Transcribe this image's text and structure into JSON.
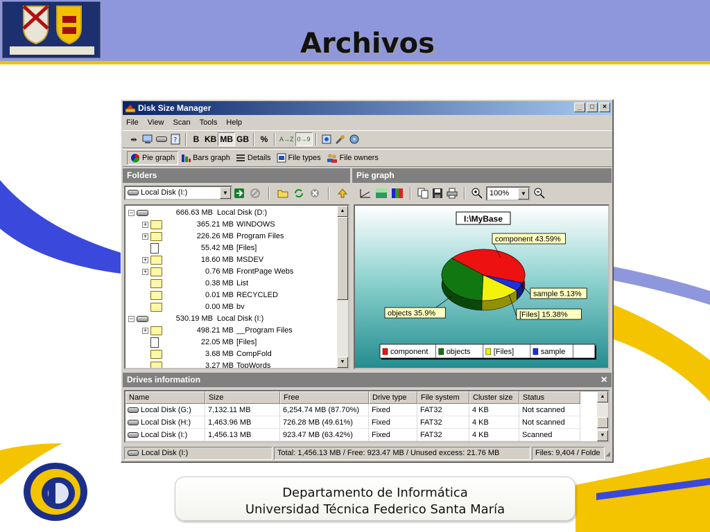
{
  "slide": {
    "title": "Archivos",
    "footer_line1": "Departamento de  Informática",
    "footer_line2": "Universidad Técnica Federico Santa María",
    "colors": {
      "header": "#8f97dc",
      "accent_gold": "#f2c200",
      "swoosh_blue": "#3344d8"
    }
  },
  "app": {
    "title": "Disk Size Manager",
    "menu": [
      "File",
      "View",
      "Scan",
      "Tools",
      "Help"
    ],
    "caption_buttons": {
      "minimize": "_",
      "maximize": "□",
      "close": "×"
    },
    "units": {
      "b": "B",
      "kb": "KB",
      "mb": "MB",
      "gb": "GB",
      "percent": "%",
      "sort_az": "A→Z",
      "sort_09": "0→9",
      "selected": "MB"
    },
    "views": {
      "pie": "Pie graph",
      "bars": "Bars graph",
      "details": "Details",
      "file_types": "File types",
      "file_owners": "File owners",
      "selected": "Pie graph"
    },
    "folders_pane": {
      "header": "Folders",
      "drive_select": "Local Disk (I:)",
      "tree": [
        {
          "level": 0,
          "expander": "−",
          "icon": "drive",
          "size": "666.63 MB",
          "name": "Local Disk (D:)"
        },
        {
          "level": 1,
          "expander": "+",
          "icon": "folder",
          "size": "365.21 MB",
          "name": "WINDOWS"
        },
        {
          "level": 1,
          "expander": "+",
          "icon": "folder",
          "size": "226.26 MB",
          "name": "Program Files"
        },
        {
          "level": 1,
          "expander": "",
          "icon": "file",
          "size": "55.42 MB",
          "name": "[Files]"
        },
        {
          "level": 1,
          "expander": "+",
          "icon": "folder",
          "size": "18.60 MB",
          "name": "MSDEV"
        },
        {
          "level": 1,
          "expander": "+",
          "icon": "folder",
          "size": "0.76 MB",
          "name": "FrontPage Webs"
        },
        {
          "level": 1,
          "expander": "",
          "icon": "folder",
          "size": "0.38 MB",
          "name": "List"
        },
        {
          "level": 1,
          "expander": "",
          "icon": "folder",
          "size": "0.01 MB",
          "name": "RECYCLED"
        },
        {
          "level": 1,
          "expander": "",
          "icon": "folder",
          "size": "0.00 MB",
          "name": "bv"
        },
        {
          "level": 0,
          "expander": "−",
          "icon": "drive",
          "size": "530.19 MB",
          "name": "Local Disk (I:)"
        },
        {
          "level": 1,
          "expander": "+",
          "icon": "folder",
          "size": "498.21 MB",
          "name": "__Program Files"
        },
        {
          "level": 1,
          "expander": "",
          "icon": "file",
          "size": "22.05 MB",
          "name": "[Files]"
        },
        {
          "level": 1,
          "expander": "",
          "icon": "folder",
          "size": "3.68 MB",
          "name": "CompFold"
        },
        {
          "level": 1,
          "expander": "",
          "icon": "folder",
          "size": "3.27 MB",
          "name": "TopWords"
        }
      ]
    },
    "graph_pane": {
      "header": "Pie graph",
      "zoom": "100%",
      "chart_title": "I:\\MyBase",
      "slices": [
        {
          "name": "component",
          "percent": 43.59,
          "label": "component 43.59%",
          "color": "#ee1111"
        },
        {
          "name": "objects",
          "percent": 35.9,
          "label": "objects 35.9%",
          "color": "#117711"
        },
        {
          "name": "[Files]",
          "percent": 15.38,
          "label": "[Files] 15.38%",
          "color": "#f2f20a"
        },
        {
          "name": "sample",
          "percent": 5.13,
          "label": "sample 5.13%",
          "color": "#1e2ee0"
        }
      ]
    },
    "drives_pane": {
      "header": "Drives information",
      "close": "×",
      "columns": [
        "Name",
        "Size",
        "Free",
        "Drive type",
        "File system",
        "Cluster size",
        "Status"
      ],
      "rows": [
        [
          "Local Disk (G:)",
          "7,132.11 MB",
          "6,254.74 MB (87.70%)",
          "Fixed",
          "FAT32",
          "4 KB",
          "Not scanned"
        ],
        [
          "Local Disk (H:)",
          "1,463.96 MB",
          "726.28 MB (49.61%)",
          "Fixed",
          "FAT32",
          "4 KB",
          "Not scanned"
        ],
        [
          "Local Disk (I:)",
          "1,456.13 MB",
          "923.47 MB (63.42%)",
          "Fixed",
          "FAT32",
          "4 KB",
          "Scanned"
        ]
      ]
    },
    "status": {
      "drive": "Local Disk (I:)",
      "totals": "Total: 1,456.13 MB / Free: 923.47 MB / Unused excess: 21.76 MB",
      "files": "Files: 9,404 / Folde"
    }
  }
}
